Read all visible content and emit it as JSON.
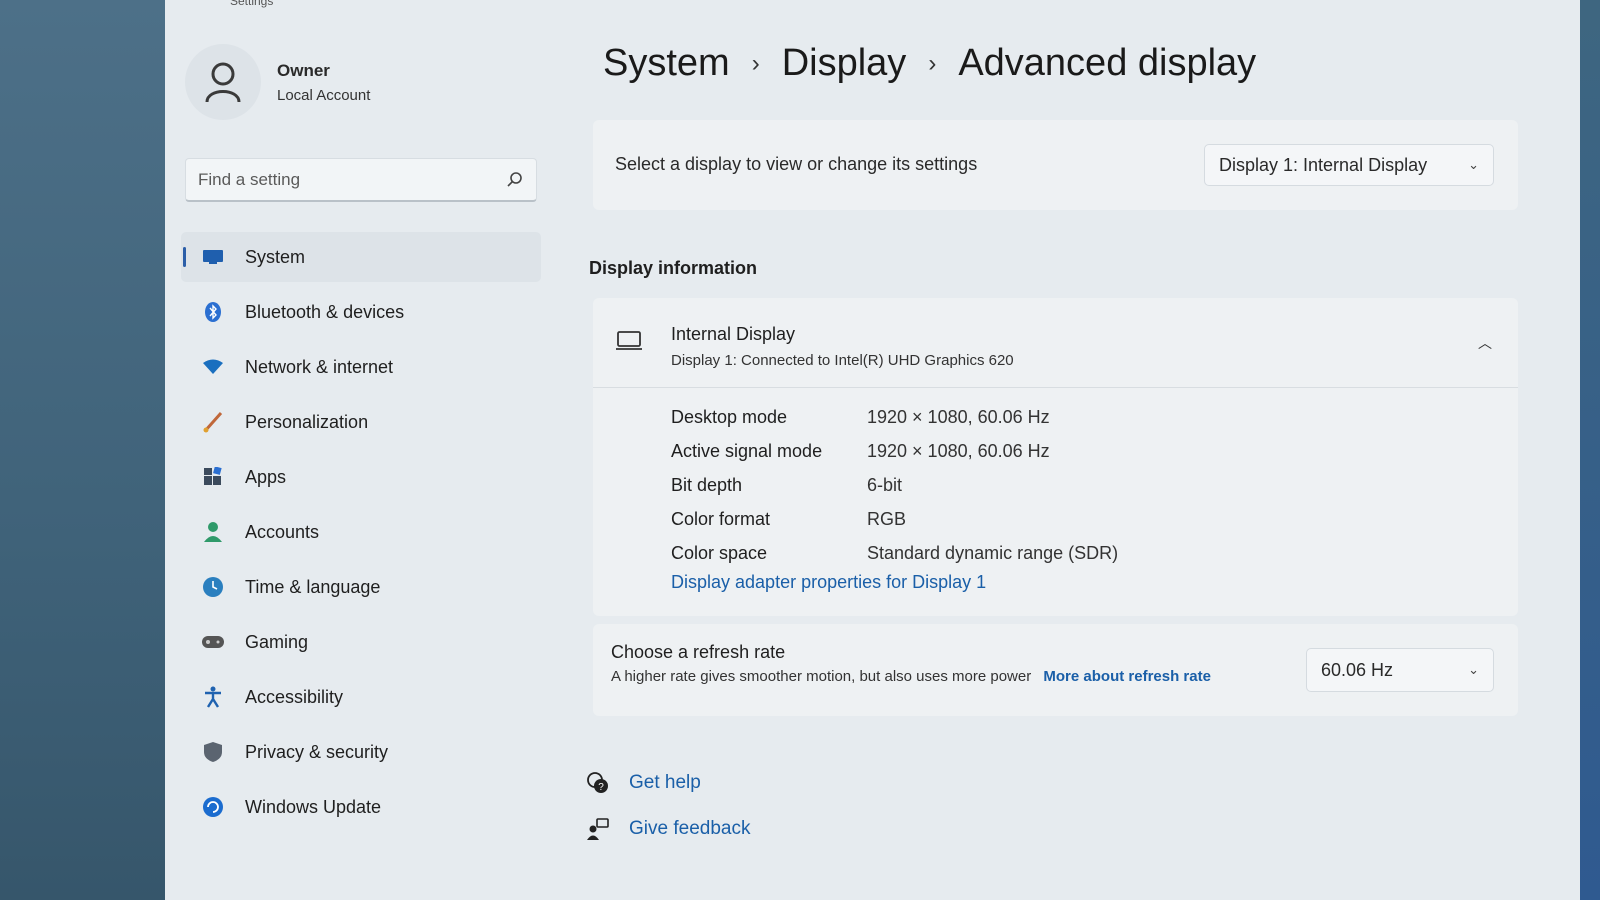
{
  "window": {
    "title": "Settings"
  },
  "profile": {
    "name": "Owner",
    "account_type": "Local Account"
  },
  "search": {
    "placeholder": "Find a setting"
  },
  "sidebar": {
    "items": [
      {
        "label": "System",
        "icon": "monitor-icon",
        "color": "#1f5fae",
        "selected": true
      },
      {
        "label": "Bluetooth & devices",
        "icon": "bluetooth-icon",
        "color": "#2b6fd1"
      },
      {
        "label": "Network & internet",
        "icon": "wifi-icon",
        "color": "#1a6fbf"
      },
      {
        "label": "Personalization",
        "icon": "brush-icon",
        "color": "#c0673a"
      },
      {
        "label": "Apps",
        "icon": "apps-icon",
        "color": "#3b4a5c"
      },
      {
        "label": "Accounts",
        "icon": "person-icon",
        "color": "#2f9a6a"
      },
      {
        "label": "Time & language",
        "icon": "globe-clock-icon",
        "color": "#2a7fbf"
      },
      {
        "label": "Gaming",
        "icon": "gamepad-icon",
        "color": "#555555"
      },
      {
        "label": "Accessibility",
        "icon": "accessibility-icon",
        "color": "#1f62b0"
      },
      {
        "label": "Privacy & security",
        "icon": "shield-icon",
        "color": "#5b6470"
      },
      {
        "label": "Windows Update",
        "icon": "update-icon",
        "color": "#1b6ccf"
      }
    ]
  },
  "breadcrumb": {
    "items": [
      "System",
      "Display",
      "Advanced display"
    ]
  },
  "display_select": {
    "label": "Select a display to view or change its settings",
    "value": "Display 1: Internal Display"
  },
  "display_info": {
    "section_title": "Display information",
    "name": "Internal Display",
    "connection": "Display 1: Connected to Intel(R) UHD Graphics 620",
    "rows": [
      {
        "key": "Desktop mode",
        "value": "1920 × 1080, 60.06 Hz"
      },
      {
        "key": "Active signal mode",
        "value": "1920 × 1080, 60.06 Hz"
      },
      {
        "key": "Bit depth",
        "value": "6-bit"
      },
      {
        "key": "Color format",
        "value": "RGB"
      },
      {
        "key": "Color space",
        "value": "Standard dynamic range (SDR)"
      }
    ],
    "adapter_link": "Display adapter properties for Display 1"
  },
  "refresh_rate": {
    "title": "Choose a refresh rate",
    "description": "A higher rate gives smoother motion, but also uses more power",
    "link": "More about refresh rate",
    "value": "60.06 Hz"
  },
  "footer": {
    "get_help": "Get help",
    "give_feedback": "Give feedback"
  },
  "colors": {
    "accent": "#1a5fa8",
    "window_bg": "#e6ebef",
    "card_bg": "#eef1f3"
  }
}
